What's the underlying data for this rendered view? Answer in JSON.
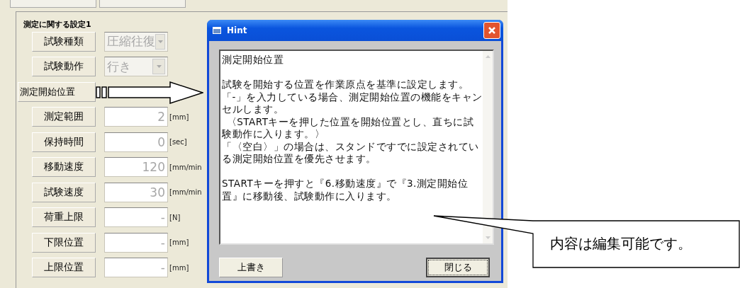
{
  "settings_group": {
    "title": "測定に関する設定1",
    "rows": [
      {
        "kind": "combo",
        "label": "試験種類",
        "value": "圧縮往復"
      },
      {
        "kind": "combo",
        "label": "試験動作",
        "value": "行き"
      },
      {
        "kind": "text",
        "label": "測定開始位置"
      },
      {
        "kind": "text",
        "label": "測定範囲",
        "value": "2",
        "unit": "[mm]"
      },
      {
        "kind": "text",
        "label": "保持時間",
        "value": "0",
        "unit": "[sec]"
      },
      {
        "kind": "text",
        "label": "移動速度",
        "value": "120",
        "unit": "[mm/min"
      },
      {
        "kind": "text",
        "label": "試験速度",
        "value": "30",
        "unit": "[mm/min"
      },
      {
        "kind": "text",
        "label": "荷重上限",
        "value": "-",
        "unit": "[N]"
      },
      {
        "kind": "text",
        "label": "下限位置",
        "value": "-",
        "unit": "[mm]"
      },
      {
        "kind": "text",
        "label": "上限位置",
        "value": "-",
        "unit": "[mm]"
      }
    ]
  },
  "hint_dialog": {
    "title": "Hint",
    "paragraphs": [
      "測定開始位置",
      "試験を開始する位置を作業原点を基準に設定します。",
      "「-」を入力している場合、測定開始位置の機能をキャンセルします。",
      "〈STARTキーを押した位置を開始位置とし、直ちに試験動作に入ります。〉",
      "「〈空白〉」の場合は、スタンドですでに設定されている測定開始位置を優先させます。",
      "STARTキーを押すと『6.移動速度』で『3.測定開始位置』に移動後、試験動作に入ります。"
    ],
    "buttons": [
      {
        "label": "上書き",
        "focused": false
      },
      {
        "label": "閉じる",
        "focused": true
      }
    ]
  },
  "callout": {
    "text": "内容は編集可能です。"
  }
}
